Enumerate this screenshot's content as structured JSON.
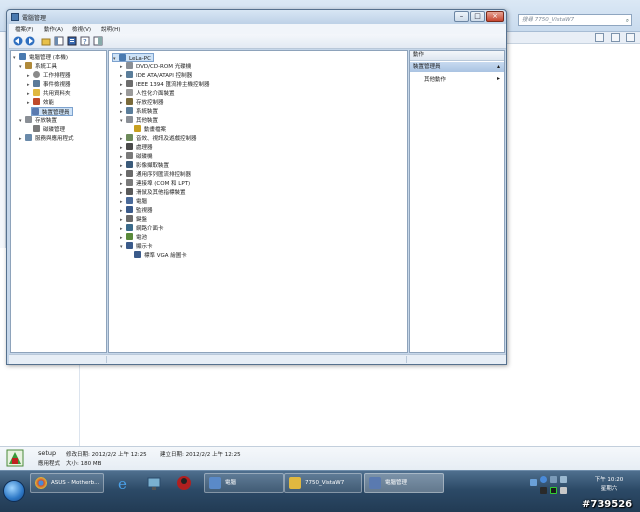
{
  "background_window": {
    "search_placeholder": "搜尋 7750_VistaW7",
    "details": {
      "name": "setup",
      "modified_label": "修改日期: 2012/2/2 上午 12:25",
      "created_label": "建立日期: 2012/2/2 上午 12:25",
      "type_label": "應用程式",
      "size_label": "大小: 180 MB"
    }
  },
  "window": {
    "title": "電腦管理",
    "menu": [
      "檔案(F)",
      "動作(A)",
      "檢視(V)",
      "說明(H)"
    ],
    "left_tree": [
      {
        "label": "電腦管理 (本機)",
        "level": 0,
        "expander": "▾"
      },
      {
        "label": "系統工具",
        "level": 1,
        "expander": "▾"
      },
      {
        "label": "工作排程器",
        "level": 2,
        "expander": "▸"
      },
      {
        "label": "事件檢視器",
        "level": 2,
        "expander": "▸"
      },
      {
        "label": "共用資料夾",
        "level": 2,
        "expander": "▸"
      },
      {
        "label": "效能",
        "level": 2,
        "expander": "▸"
      },
      {
        "label": "裝置管理員",
        "level": 2,
        "expander": "",
        "selected": true
      },
      {
        "label": "存放裝置",
        "level": 1,
        "expander": "▾"
      },
      {
        "label": "磁碟管理",
        "level": 2,
        "expander": ""
      },
      {
        "label": "服務與應用程式",
        "level": 1,
        "expander": "▸"
      }
    ],
    "device_tree": [
      {
        "label": "LeLa-PC",
        "level": 0,
        "expander": "▾",
        "color": "#4a7ab0"
      },
      {
        "label": "DVD/CD-ROM 光碟機",
        "level": 1,
        "expander": "▸",
        "color": "#8a8f96"
      },
      {
        "label": "IDE ATA/ATAPI 控制器",
        "level": 1,
        "expander": "▸",
        "color": "#5a7d9a"
      },
      {
        "label": "IEEE 1394 匯流排主機控制器",
        "level": 1,
        "expander": "▸",
        "color": "#6d6d6d"
      },
      {
        "label": "人性化介面裝置",
        "level": 1,
        "expander": "▸",
        "color": "#9a9a9a"
      },
      {
        "label": "存放控制器",
        "level": 1,
        "expander": "▸",
        "color": "#7a6a3a"
      },
      {
        "label": "系統裝置",
        "level": 1,
        "expander": "▸",
        "color": "#5a7d9a"
      },
      {
        "label": "其他裝置",
        "level": 1,
        "expander": "▾",
        "color": "#8a8f96"
      },
      {
        "label": "動畫檔案",
        "level": 2,
        "expander": "",
        "color": "#c8a020"
      },
      {
        "label": "音效、視訊及遊戲控制器",
        "level": 1,
        "expander": "▸",
        "color": "#6d8a5a"
      },
      {
        "label": "處理器",
        "level": 1,
        "expander": "▸",
        "color": "#4a4a4a"
      },
      {
        "label": "磁碟機",
        "level": 1,
        "expander": "▸",
        "color": "#7a7a7a"
      },
      {
        "label": "影像擷取裝置",
        "level": 1,
        "expander": "▸",
        "color": "#3a5a7a"
      },
      {
        "label": "通用序列匯流排控制器",
        "level": 1,
        "expander": "▸",
        "color": "#6a6a6a"
      },
      {
        "label": "連接埠 (COM 和 LPT)",
        "level": 1,
        "expander": "▸",
        "color": "#7a7a7a"
      },
      {
        "label": "滑鼠及其他指標裝置",
        "level": 1,
        "expander": "▸",
        "color": "#5a5a5a"
      },
      {
        "label": "電腦",
        "level": 1,
        "expander": "▸",
        "color": "#4a6a9a"
      },
      {
        "label": "監視器",
        "level": 1,
        "expander": "▸",
        "color": "#3a5a8a"
      },
      {
        "label": "鍵盤",
        "level": 1,
        "expander": "▸",
        "color": "#6a6a6a"
      },
      {
        "label": "網路介面卡",
        "level": 1,
        "expander": "▸",
        "color": "#3a6a8a"
      },
      {
        "label": "電池",
        "level": 1,
        "expander": "▸",
        "color": "#5a8a3a"
      },
      {
        "label": "顯示卡",
        "level": 1,
        "expander": "▾",
        "color": "#3a5a8a"
      },
      {
        "label": "標準 VGA 繪圖卡",
        "level": 2,
        "expander": "",
        "color": "#3a5a8a"
      }
    ],
    "actions_pane": {
      "header": "動作",
      "section": "裝置管理員",
      "more": "其他動作"
    }
  },
  "taskbar": {
    "buttons": [
      {
        "label": "ASUS - Motherb...",
        "color": "#d04a2a"
      },
      {
        "label": "電腦",
        "color": "#5a8ac8"
      },
      {
        "label": "7750_VistaW7",
        "color": "#e0b840"
      },
      {
        "label": "電腦管理",
        "color": "#5a7ab0"
      }
    ],
    "clock_time": "下午 10:20",
    "clock_day": "星期六"
  },
  "watermark": "#739526"
}
